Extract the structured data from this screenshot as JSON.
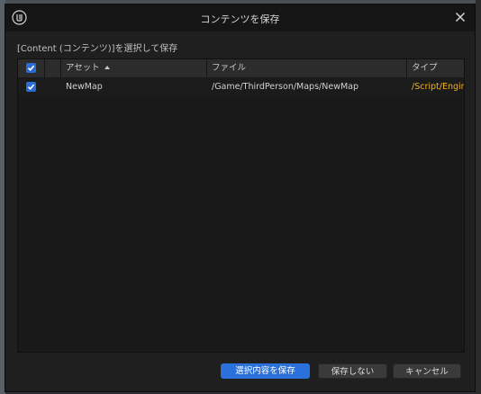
{
  "dialog": {
    "title": "コンテンツを保存",
    "subtitle": "[Content (コンテンツ)]を選択して保存"
  },
  "table": {
    "columns": {
      "asset": "アセット",
      "file": "ファイル",
      "type": "タイプ"
    },
    "rows": [
      {
        "checked": true,
        "asset": "NewMap",
        "file": "/Game/ThirdPerson/Maps/NewMap",
        "type": "/Script/Engine.World"
      }
    ]
  },
  "buttons": {
    "save_selected": "選択内容を保存",
    "dont_save": "保存しない",
    "cancel": "キャンセル"
  },
  "colors": {
    "accent": "#2a71dc",
    "type_text": "#f0b21a"
  },
  "icons": {
    "logo": "unreal-engine-logo",
    "close": "close-icon",
    "check": "checkmark-icon"
  }
}
